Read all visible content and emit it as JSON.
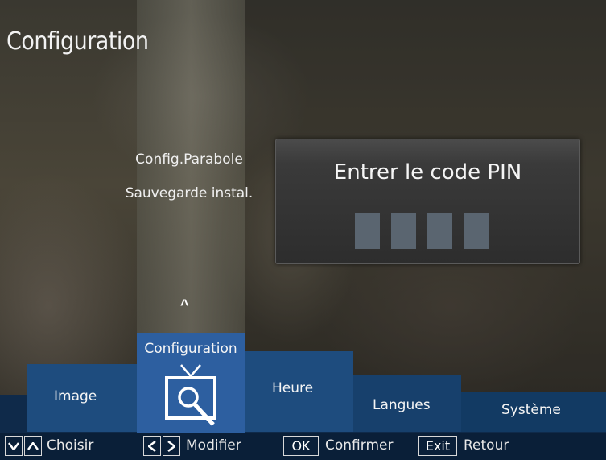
{
  "screen": {
    "title": "Configuration"
  },
  "submenu": {
    "items": [
      "Config.Parabole",
      "Sauvegarde instal."
    ]
  },
  "pin_dialog": {
    "prompt": "Entrer le code PIN",
    "digits_entered": 0,
    "digit_slots": 4
  },
  "main_menu": {
    "items": [
      {
        "label": "Image"
      },
      {
        "label": "Configuration",
        "selected": true,
        "icon": "tv-search-icon"
      },
      {
        "label": "Heure"
      },
      {
        "label": "Langues"
      },
      {
        "label": "Système"
      }
    ],
    "up_indicator": "^"
  },
  "help_bar": {
    "choose_label": "Choisir",
    "modify_label": "Modifier",
    "ok_key": "OK",
    "confirm_label": "Confirmer",
    "exit_key": "Exit",
    "back_label": "Retour"
  },
  "colors": {
    "accent": "#2d5fa0",
    "menu_tab": "#1e4c7e",
    "band": "#0f2a4a",
    "pin_slot": "#5a6570"
  }
}
